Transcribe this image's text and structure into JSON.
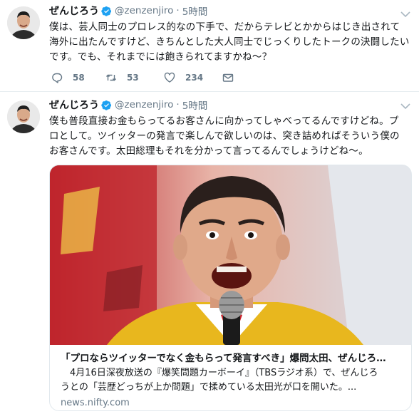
{
  "colors": {
    "verified": "#1da1f2",
    "secondary_text": "#657786",
    "primary_text": "#14171a",
    "divider": "#e6ecf0"
  },
  "icons": {
    "reply": "reply-icon",
    "retweet": "retweet-icon",
    "like": "heart-icon",
    "direct_message": "envelope-icon",
    "verified": "verified-badge-icon",
    "more": "chevron-down-icon"
  },
  "tweets": [
    {
      "display_name": "ぜんじろう",
      "handle": "@zenzenjiro",
      "separator": "·",
      "timestamp": "5時間",
      "text_lines": [
        "僕は、芸人同士のプロレス的なの下手で、だからテレビとかからはじき出されて",
        "海外に出たんですけど、きちんとした大人同士でじっくりしたトークの決闘したい",
        "です。でも、それまでには飽きられてますかね〜？"
      ],
      "reply_count": "58",
      "retweet_count": "53",
      "like_count": "234"
    },
    {
      "display_name": "ぜんじろう",
      "handle": "@zenzenjiro",
      "separator": "·",
      "timestamp": "5時間",
      "text_lines": [
        "僕も普段直接お金もらってるお客さんに向かってしゃべってるんですけどね。プ",
        "ロとして。ツイッターの発言で楽しんで欲しいのは、突き詰めればそういう僕の",
        "お客さんです。太田総理もそれを分かって言ってるんでしょうけどね〜。"
      ],
      "card": {
        "title": "「プロならツイッターでなく金もらって発言すべき」爆問太田、ぜんじろ…",
        "description_lines": [
          "　4月16日深夜放送の『爆笑問題カーボーイ』（TBSラジオ系）で、ぜんじろ",
          "うとの「芸歴どっちが上か問題」で揉めている太田光が口を開いた。..."
        ],
        "domain": "news.nifty.com"
      }
    }
  ]
}
